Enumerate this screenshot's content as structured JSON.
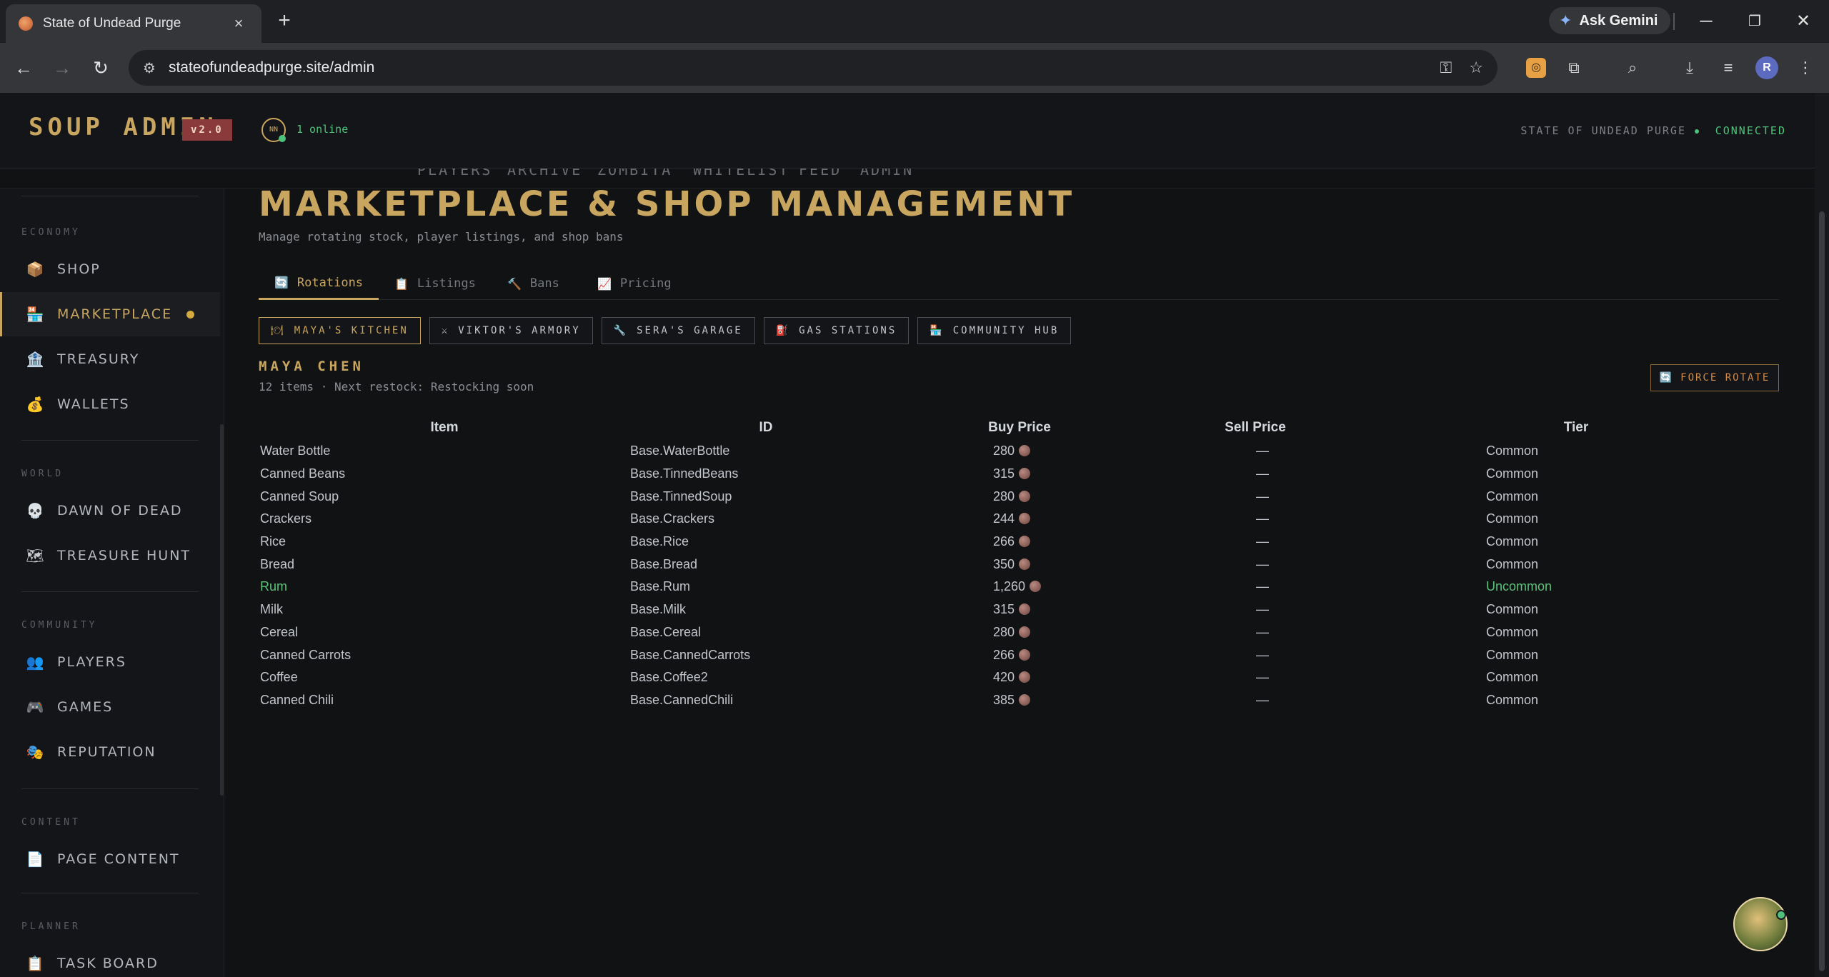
{
  "browser": {
    "tab_title": "State of Undead Purge",
    "url": "stateofundeadpurge.site/admin",
    "gemini_label": "Ask Gemini",
    "profile_initial": "R"
  },
  "header": {
    "brand": "SOUP ADMIN",
    "version": "v2.0",
    "online_avatar": "NN",
    "online_count": "1 online",
    "server_name": "STATE OF UNDEAD PURGE",
    "status": "CONNECTED"
  },
  "subnav": [
    "PLAYERS",
    "ARCHIVE",
    "ZOMBITA",
    "WHITELIST",
    "FEED",
    "ADMIN"
  ],
  "sidebar": {
    "sections": [
      {
        "label": "ECONOMY",
        "items": [
          {
            "label": "SHOP",
            "icon": "📦"
          },
          {
            "label": "MARKETPLACE",
            "icon": "🏪",
            "active": true
          },
          {
            "label": "TREASURY",
            "icon": "🏦"
          },
          {
            "label": "WALLETS",
            "icon": "💰"
          }
        ]
      },
      {
        "label": "WORLD",
        "items": [
          {
            "label": "DAWN OF DEAD",
            "icon": "💀"
          },
          {
            "label": "TREASURE HUNT",
            "icon": "🗺"
          }
        ]
      },
      {
        "label": "COMMUNITY",
        "items": [
          {
            "label": "PLAYERS",
            "icon": "👥"
          },
          {
            "label": "GAMES",
            "icon": "🎮"
          },
          {
            "label": "REPUTATION",
            "icon": "🎭"
          }
        ]
      },
      {
        "label": "CONTENT",
        "items": [
          {
            "label": "PAGE CONTENT",
            "icon": "📄"
          }
        ]
      },
      {
        "label": "PLANNER",
        "items": [
          {
            "label": "TASK BOARD",
            "icon": "📋"
          }
        ]
      }
    ]
  },
  "page": {
    "title": "MARKETPLACE & SHOP MANAGEMENT",
    "subtitle": "Manage rotating stock, player listings, and shop bans",
    "tabs": [
      {
        "label": "Rotations",
        "icon": "🔄",
        "active": true
      },
      {
        "label": "Listings",
        "icon": "📋"
      },
      {
        "label": "Bans",
        "icon": "🔨"
      },
      {
        "label": "Pricing",
        "icon": "📈"
      }
    ],
    "shops": [
      {
        "label": "MAYA'S KITCHEN",
        "icon": "🍽",
        "active": true
      },
      {
        "label": "VIKTOR'S ARMORY",
        "icon": "⚔"
      },
      {
        "label": "SERA'S GARAGE",
        "icon": "🔧"
      },
      {
        "label": "GAS STATIONS",
        "icon": "⛽"
      },
      {
        "label": "COMMUNITY HUB",
        "icon": "🏪"
      }
    ],
    "vendor_name": "MAYA CHEN",
    "vendor_meta": "12 items · Next restock: Restocking soon",
    "force_rotate": "FORCE ROTATE"
  },
  "table": {
    "columns": [
      "Item",
      "ID",
      "Buy Price",
      "Sell Price",
      "Tier"
    ],
    "rows": [
      {
        "item": "Water Bottle",
        "id": "Base.WaterBottle",
        "buy": "280",
        "sell": "—",
        "tier": "Common"
      },
      {
        "item": "Canned Beans",
        "id": "Base.TinnedBeans",
        "buy": "315",
        "sell": "—",
        "tier": "Common"
      },
      {
        "item": "Canned Soup",
        "id": "Base.TinnedSoup",
        "buy": "280",
        "sell": "—",
        "tier": "Common"
      },
      {
        "item": "Crackers",
        "id": "Base.Crackers",
        "buy": "244",
        "sell": "—",
        "tier": "Common"
      },
      {
        "item": "Rice",
        "id": "Base.Rice",
        "buy": "266",
        "sell": "—",
        "tier": "Common"
      },
      {
        "item": "Bread",
        "id": "Base.Bread",
        "buy": "350",
        "sell": "—",
        "tier": "Common"
      },
      {
        "item": "Rum",
        "id": "Base.Rum",
        "buy": "1,260",
        "sell": "—",
        "tier": "Uncommon"
      },
      {
        "item": "Milk",
        "id": "Base.Milk",
        "buy": "315",
        "sell": "—",
        "tier": "Common"
      },
      {
        "item": "Cereal",
        "id": "Base.Cereal",
        "buy": "280",
        "sell": "—",
        "tier": "Common"
      },
      {
        "item": "Canned Carrots",
        "id": "Base.CannedCarrots",
        "buy": "266",
        "sell": "—",
        "tier": "Common"
      },
      {
        "item": "Coffee",
        "id": "Base.Coffee2",
        "buy": "420",
        "sell": "—",
        "tier": "Common"
      },
      {
        "item": "Canned Chili",
        "id": "Base.CannedChili",
        "buy": "385",
        "sell": "—",
        "tier": "Common"
      }
    ]
  }
}
